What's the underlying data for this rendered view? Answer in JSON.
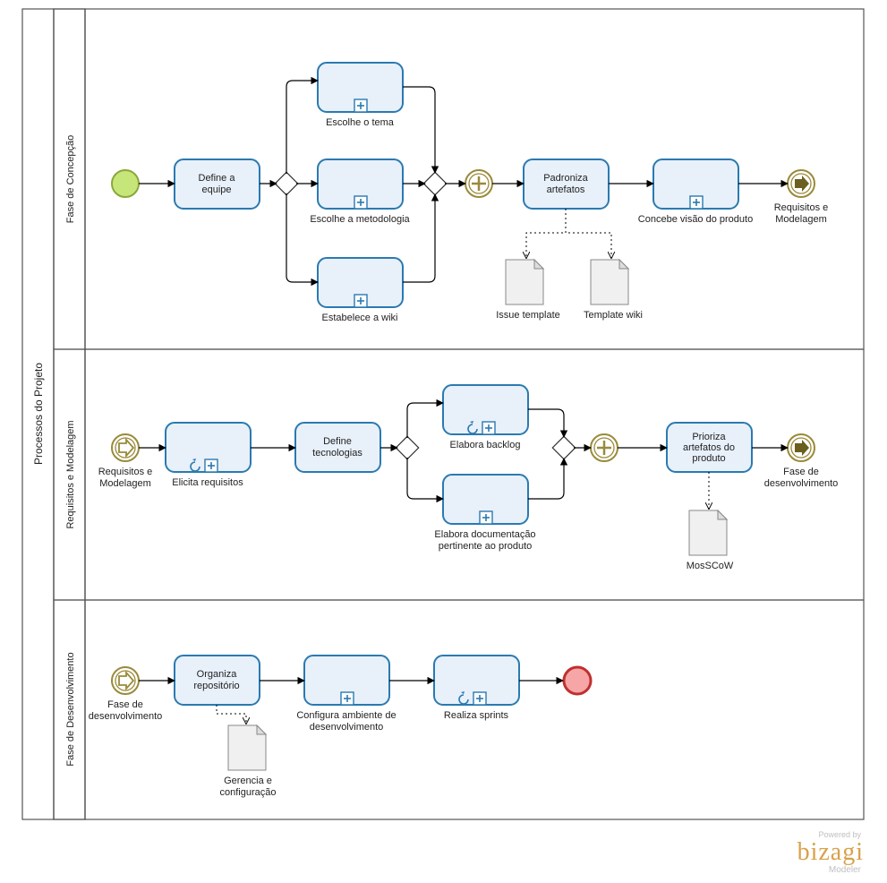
{
  "pool": {
    "title": "Processos do Projeto"
  },
  "lanes": {
    "lane1": {
      "title": "Fase de Concepção"
    },
    "lane2": {
      "title": "Requisitos e Modelagem"
    },
    "lane3": {
      "title": "Fase de Desenvolvimento"
    }
  },
  "tasks": {
    "t_define_equipe": {
      "label": "Define a",
      "label2": "equipe",
      "below": ""
    },
    "t_escolhe_tema": {
      "below": "Escolhe o tema"
    },
    "t_escolhe_metod": {
      "below": "Escolhe a metodologia"
    },
    "t_estabelece_wiki": {
      "below": "Estabelece a wiki"
    },
    "t_padroniza": {
      "label": "Padroniza",
      "label2": "artefatos"
    },
    "t_concebe_visao": {
      "below": "Concebe visão do produto"
    },
    "t_elicita": {
      "below": "Elicita requisitos"
    },
    "t_define_tec": {
      "label": "Define",
      "label2": "tecnologias"
    },
    "t_elabora_backlog": {
      "below": "Elabora backlog"
    },
    "t_elabora_doc": {
      "below": "Elabora documentação",
      "below2": "pertinente ao produto"
    },
    "t_prioriza": {
      "label": "Prioriza",
      "label2": "artefatos do",
      "label3": "produto"
    },
    "t_organiza_repo": {
      "label": "Organiza",
      "label2": "repositório"
    },
    "t_config_amb": {
      "below": "Configura ambiente de",
      "below2": "desenvolvimento"
    },
    "t_realiza_sprints": {
      "below": "Realiza sprints"
    }
  },
  "events": {
    "link_out_1": {
      "label": "Requisitos e",
      "label2": "Modelagem"
    },
    "link_in_2": {
      "label": "Requisitos e",
      "label2": "Modelagem"
    },
    "link_out_2": {
      "label": "Fase de",
      "label2": "desenvolvimento"
    },
    "link_in_3": {
      "label": "Fase de",
      "label2": "desenvolvimento"
    }
  },
  "artifacts": {
    "a_issue": {
      "label": "Issue template"
    },
    "a_wiki": {
      "label": "Template wiki"
    },
    "a_moscow": {
      "label": "MosSCoW"
    },
    "a_gerencia": {
      "label": "Gerencia e",
      "label2": "configuração"
    }
  },
  "branding": {
    "powered": "Powered by",
    "name": "bizagi",
    "product": "Modeler"
  }
}
